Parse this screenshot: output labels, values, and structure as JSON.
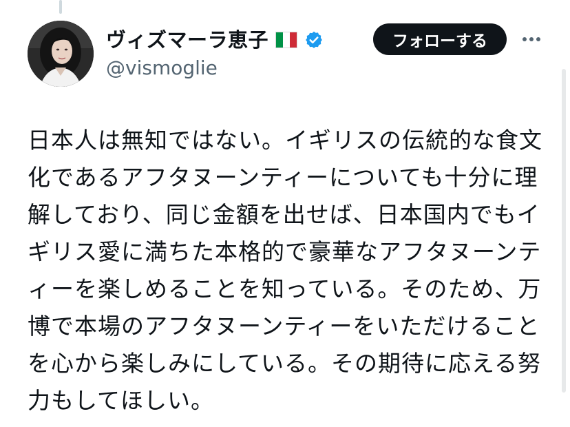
{
  "user": {
    "display_name": "ヴィズマーラ恵子",
    "handle": "@vismoglie",
    "flag_colors": [
      "#009246",
      "#ffffff",
      "#ce2b37"
    ],
    "verified_color": "#1d9bf0",
    "avatar_icon": "profile-photo"
  },
  "actions": {
    "follow_label": "フォローする",
    "more_icon": "more-dots-icon"
  },
  "tweet": {
    "lines": [
      "日本人は無知ではない。イギリスの伝統的な食文",
      "化であるアフタヌーンティーについても十分に理",
      "解しており、同じ金額を出せば、日本国内でもイ",
      "ギリス愛に満ちた本格的で豪華なアフタヌーンテ",
      "ィーを楽しめることを知っている。そのため、万",
      "博で本場のアフタヌーンティーをいただけること",
      "を心から楽しみにしている。その期待に応える努",
      "力もしてほしい。"
    ]
  }
}
